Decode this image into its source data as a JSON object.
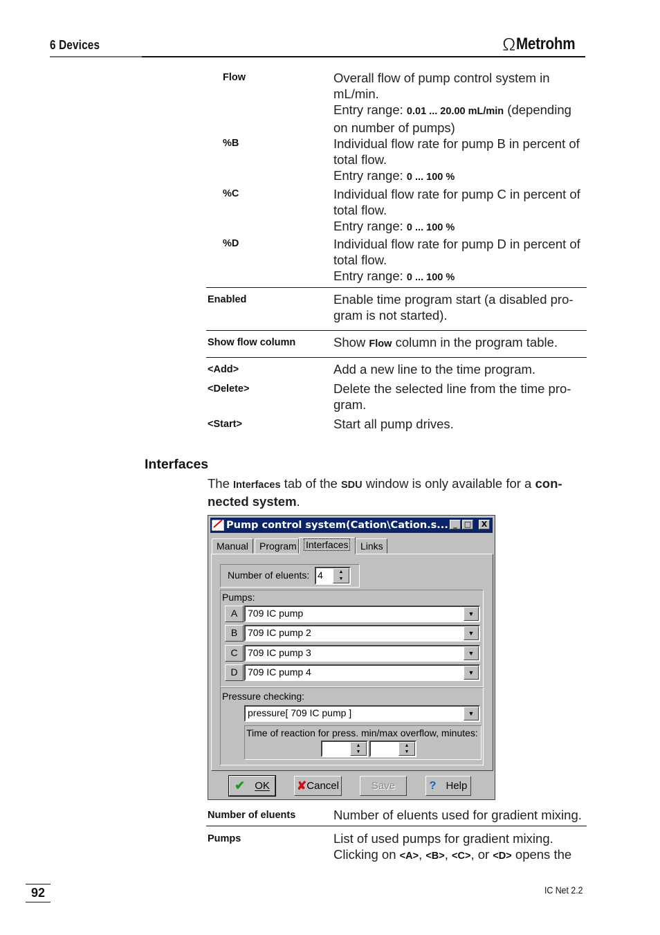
{
  "header": {
    "chapter": "6  Devices",
    "brand": "Metrohm",
    "logo_icon": "omega-icon"
  },
  "params_top": [
    {
      "term": "Flow",
      "lines": [
        "Overall flow of pump control system in",
        "mL/min."
      ],
      "range_prefix": "Entry range: ",
      "range_value": "0.01 ... 20.00 mL/min",
      "range_suffix": " (depending",
      "extra_line": "on number of pumps)"
    },
    {
      "term": "%B",
      "lines": [
        "Individual flow rate for pump B in percent of",
        "total flow."
      ],
      "range_prefix": "Entry range: ",
      "range_value": "0 ... 100 %"
    },
    {
      "term": "%C",
      "lines": [
        "Individual flow rate for pump C in percent of",
        "total flow."
      ],
      "range_prefix": "Entry range: ",
      "range_value": "0 ... 100 %"
    },
    {
      "term": "%D",
      "lines": [
        "Individual flow rate for pump D in percent of",
        "total flow."
      ],
      "range_prefix": "Entry range: ",
      "range_value": "0 ... 100 %"
    }
  ],
  "enabled": {
    "term": "Enabled",
    "line1": "Enable time program start (a disabled pro-",
    "line2": "gram is not started)."
  },
  "show_flow": {
    "term": "Show flow column",
    "pre": "Show ",
    "bold": "Flow",
    "post": " column in the program table."
  },
  "buttons_doc": [
    {
      "term": "<Add>",
      "line1": "Add a new line to the time program."
    },
    {
      "term": "<Delete>",
      "line1": "Delete the selected line from the time pro-",
      "line2": "gram."
    },
    {
      "term": "<Start>",
      "line1": "Start all pump drives."
    }
  ],
  "interfaces": {
    "heading": "Interfaces",
    "intro": {
      "t1": "The ",
      "b1": "Interfaces",
      "t2": " tab of the ",
      "b2": "SDU",
      "t3": " window is only available for a ",
      "b3": "con-",
      "b4": "nected system",
      "t4": "."
    }
  },
  "dialog": {
    "title": "Pump control system(Cation\\Cation.s...",
    "title_buttons": {
      "minimize": "_",
      "maximize": "□",
      "close": "X"
    },
    "tabs": [
      "Manual",
      "Program",
      "Interfaces",
      "Links"
    ],
    "active_tab": "Interfaces",
    "eluents_label": "Number of eluents:",
    "eluents_value": "4",
    "pumps_label": "Pumps:",
    "pumps": [
      {
        "letter": "A",
        "value": "709 IC pump"
      },
      {
        "letter": "B",
        "value": "709 IC pump 2"
      },
      {
        "letter": "C",
        "value": "709 IC pump 3"
      },
      {
        "letter": "D",
        "value": "709 IC pump 4"
      }
    ],
    "pressure_label": "Pressure checking:",
    "pressure_value": "pressure[ 709 IC pump ]",
    "reaction_label": "Time of reaction for press. min/max overflow, minutes:",
    "reaction_min": "",
    "reaction_max": "",
    "buttons": {
      "ok": "OK",
      "cancel": "Cancel",
      "save": "Save",
      "help": "Help"
    },
    "colors": {
      "titlebar": "#0a246a",
      "face": "#c0c0c0",
      "ok_check": "#1a9a1a",
      "cancel_x": "#cc1010",
      "help_q": "#1060c0"
    }
  },
  "params_bottom": [
    {
      "term": "Number of eluents",
      "line1": "Number of eluents used for gradient mixing."
    },
    {
      "term": "Pumps",
      "line1": "List of used pumps for gradient mixing.",
      "line2_pre": "Clicking on ",
      "a": "<A>",
      "sep1": ", ",
      "b": "<B>",
      "sep2": ", ",
      "c": "<C>",
      "sep3": ", or ",
      "d": "<D>",
      "line2_post": " opens the"
    }
  ],
  "footer": {
    "page": "92",
    "product": "IC Net 2.2"
  }
}
